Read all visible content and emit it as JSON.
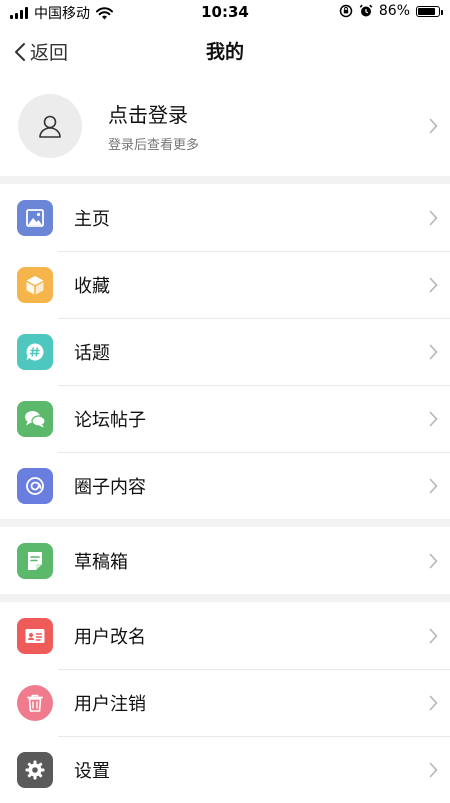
{
  "status": {
    "carrier": "中国移动",
    "time": "10:34",
    "battery": "86%",
    "battery_level": 0.86
  },
  "nav": {
    "back_label": "返回",
    "title": "我的"
  },
  "profile": {
    "name": "点击登录",
    "subtitle": "登录后查看更多"
  },
  "colors": {
    "home": "#6b86d6",
    "favorites": "#f5b54a",
    "topics": "#4ec8bf",
    "forum": "#5cb86a",
    "circle": "#6a7ee0",
    "drafts": "#5cb86a",
    "rename": "#ef5b59",
    "deactivate": "#ef7b8c",
    "settings": "#5a5a5a"
  },
  "groups": [
    {
      "items": [
        {
          "label": "主页",
          "icon": "image-icon"
        },
        {
          "label": "收藏",
          "icon": "box-icon"
        },
        {
          "label": "话题",
          "icon": "hashtag-chat-icon"
        },
        {
          "label": "论坛帖子",
          "icon": "chat-bubbles-icon"
        },
        {
          "label": "圈子内容",
          "icon": "circle-swirl-icon"
        }
      ]
    },
    {
      "items": [
        {
          "label": "草稿箱",
          "icon": "document-icon"
        }
      ]
    },
    {
      "items": [
        {
          "label": "用户改名",
          "icon": "id-card-icon"
        },
        {
          "label": "用户注销",
          "icon": "trash-icon"
        },
        {
          "label": "设置",
          "icon": "gear-icon"
        }
      ]
    }
  ]
}
